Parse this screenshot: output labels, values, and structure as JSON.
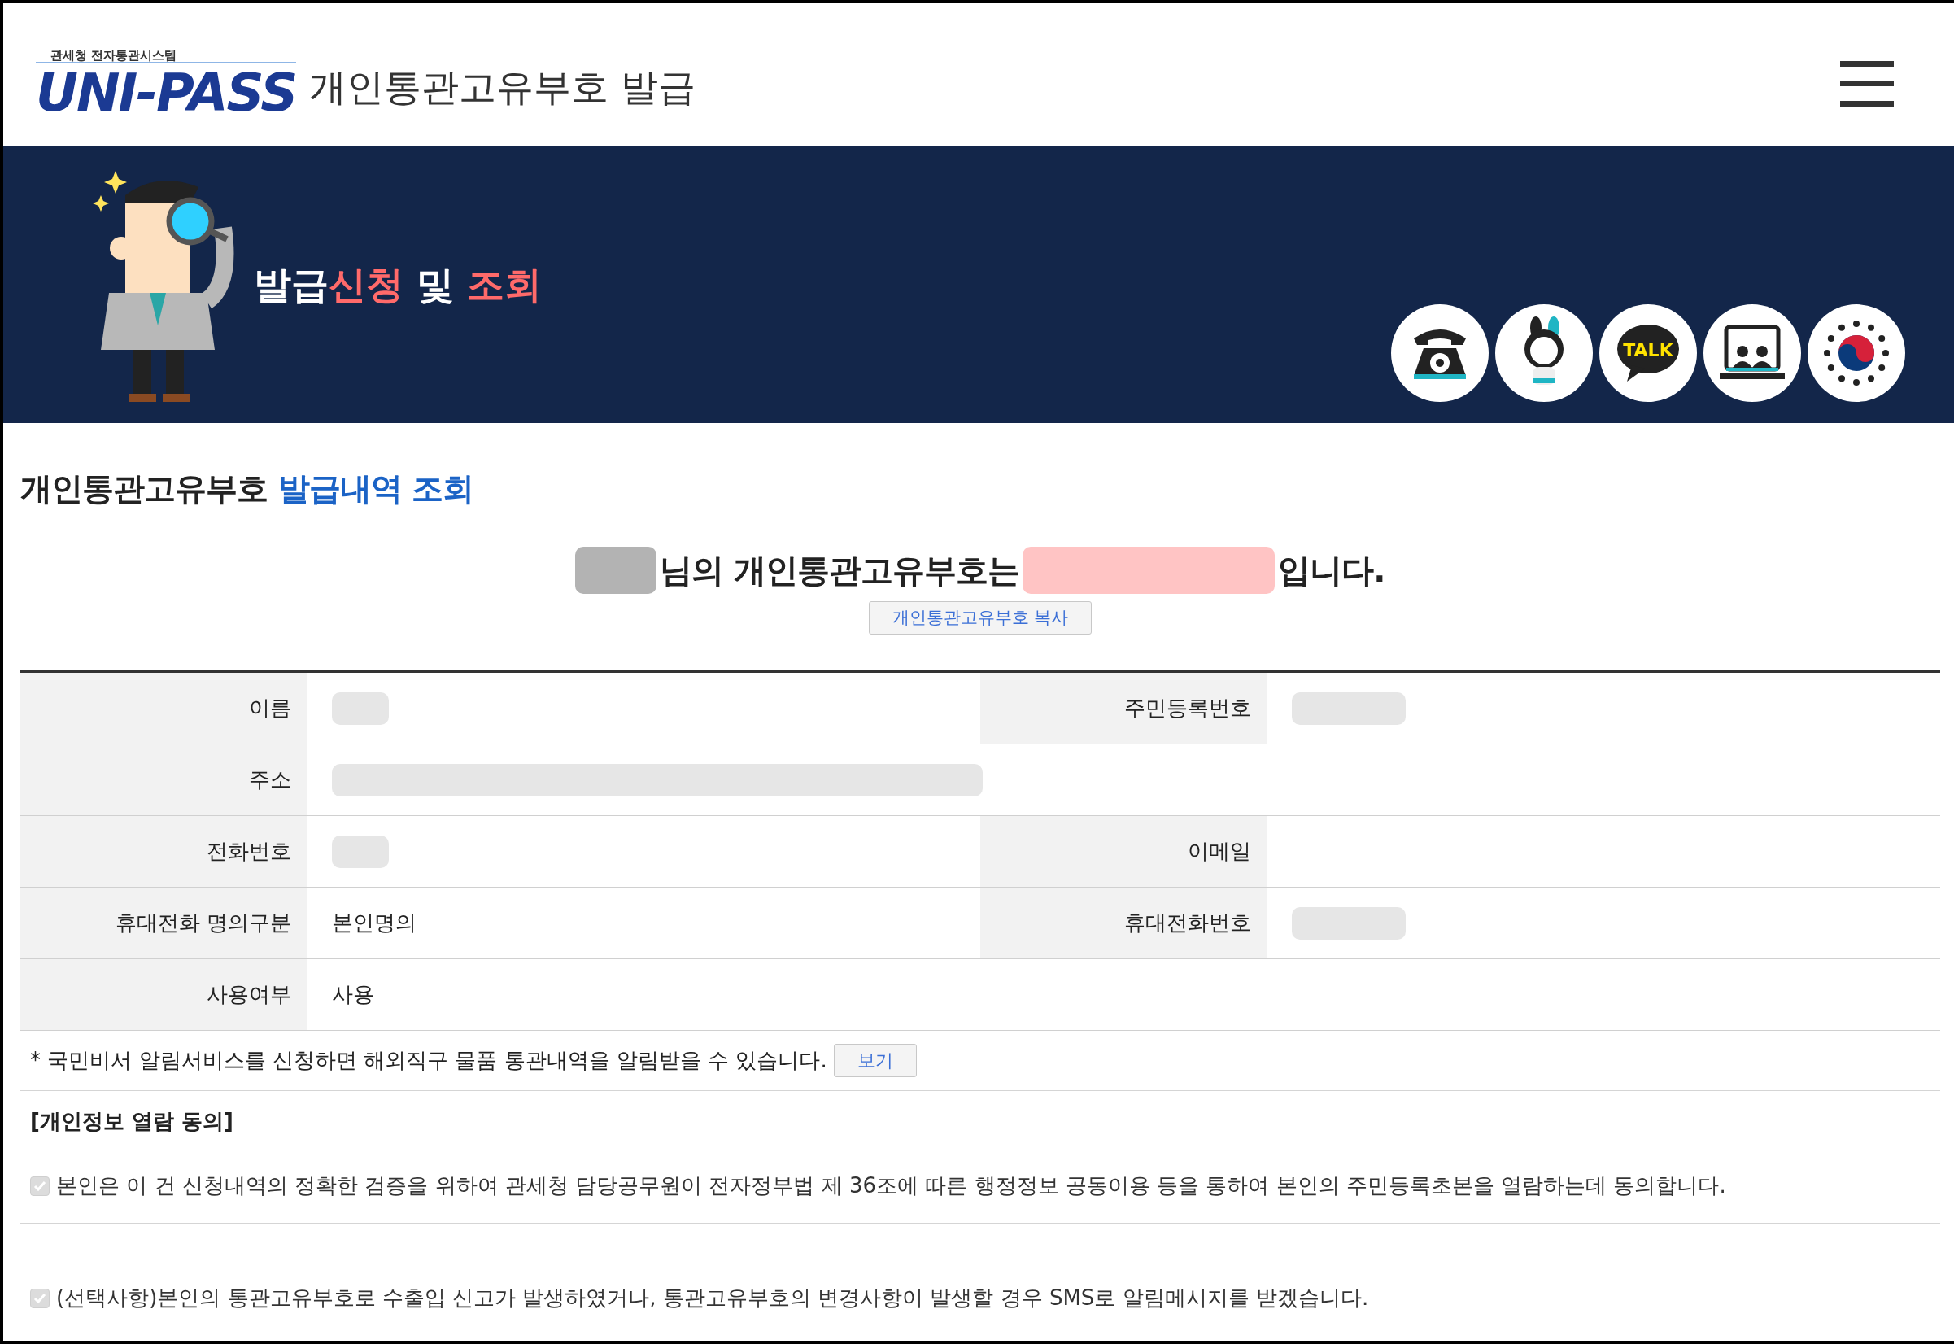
{
  "header": {
    "logo_caption": "관세청 전자통관시스템",
    "logo_text": "UNI-PASS",
    "title": "개인통관고유부호 발급"
  },
  "banner": {
    "title_parts": [
      {
        "text": "발급",
        "highlight": false
      },
      {
        "text": "신청",
        "highlight": true
      },
      {
        "text": " 및 ",
        "highlight": false
      },
      {
        "text": "조회",
        "highlight": true
      }
    ],
    "shortcuts": [
      {
        "kind": "phone"
      },
      {
        "kind": "mascot"
      },
      {
        "kind": "talk",
        "label": "TALK"
      },
      {
        "kind": "video"
      },
      {
        "kind": "emblem"
      }
    ]
  },
  "section_title": [
    {
      "text": "개인통관고유부호 ",
      "highlight": false
    },
    {
      "text": "발급내역 조회",
      "highlight": true
    }
  ],
  "result_message": [
    {
      "kind": "redacted",
      "color": "#b3b3b3"
    },
    {
      "kind": "text",
      "text": "님의 개인통관고유부호는"
    },
    {
      "kind": "redacted",
      "color": "#ffc4c4"
    },
    {
      "kind": "text",
      "text": "입니다."
    }
  ],
  "copy_button": "개인통관고유부호 복사",
  "table": {
    "rows": [
      {
        "cells": [
          {
            "label": "이름",
            "redacted": true
          },
          {
            "label": "주민등록번호",
            "redacted": true
          }
        ]
      },
      {
        "cells": [
          {
            "label": "주소",
            "redacted": true
          }
        ]
      },
      {
        "cells": [
          {
            "label": "전화번호",
            "redacted": true
          },
          {
            "label": "이메일",
            "redacted": false
          }
        ]
      },
      {
        "cells": [
          {
            "label": "휴대전화 명의구분",
            "value": "본인명의"
          },
          {
            "label": "휴대전화번호",
            "redacted": true
          }
        ]
      },
      {
        "cells": [
          {
            "label": "사용여부",
            "value": "사용"
          }
        ]
      }
    ]
  },
  "notice": {
    "text": "* 국민비서 알림서비스를 신청하면 해외직구 물품 통관내역을 알림받을 수 있습니다.",
    "button": "보기"
  },
  "consent": {
    "heading": "[개인정보 열람 동의]",
    "items": [
      {
        "text": "본인은 이 건 신청내역의 정확한 검증을 위하여 관세청 담당공무원이 전자정부법 제 36조에 따른 행정정보 공동이용 등을 통하여 본인의 주민등록초본을 열람하는데 동의합니다.",
        "checked": true,
        "disabled": true
      },
      {
        "text": "(선택사항)본인의 통관고유부호로 수출입 신고가 발생하였거나, 통관고유부호의 변경사항이 발생할 경우 SMS로 알림메시지를 받겠습니다.",
        "checked": true,
        "disabled": true
      }
    ]
  }
}
